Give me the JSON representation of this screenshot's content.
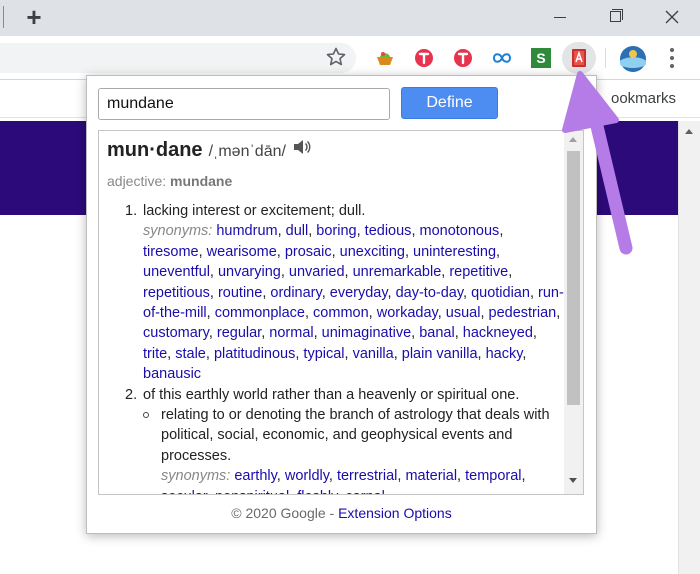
{
  "browser": {
    "new_tab_symbol": "+",
    "bookmarks_label": "ookmarks"
  },
  "popup": {
    "input_value": "mundane",
    "define_label": "Define",
    "headword": "mun·dane",
    "pronunciation": "/ˌmənˈdān/",
    "pos_label": "adjective:",
    "pos_word": "mundane",
    "definitions": [
      {
        "number": "1.",
        "text": "lacking interest or excitement; dull.",
        "synonyms_label": "synonyms:",
        "synonyms": [
          "humdrum",
          "dull",
          "boring",
          "tedious",
          "monotonous",
          "tiresome",
          "wearisome",
          "prosaic",
          "unexciting",
          "uninteresting",
          "uneventful",
          "unvarying",
          "unvaried",
          "unremarkable",
          "repetitive",
          "repetitious",
          "routine",
          "ordinary",
          "everyday",
          "day-to-day",
          "quotidian",
          "run-of-the-mill",
          "commonplace",
          "common",
          "workaday",
          "usual",
          "pedestrian",
          "customary",
          "regular",
          "normal",
          "unimaginative",
          "banal",
          "hackneyed",
          "trite",
          "stale",
          "platitudinous",
          "typical",
          "vanilla",
          "plain vanilla",
          "hacky",
          "banausic"
        ]
      },
      {
        "number": "2.",
        "text": "of this earthly world rather than a heavenly or spiritual one.",
        "sub": {
          "text": "relating to or denoting the branch of astrology that deals with political, social, economic, and geophysical events and processes.",
          "synonyms_label": "synonyms:",
          "synonyms": [
            "earthly",
            "worldly",
            "terrestrial",
            "material",
            "temporal",
            "secular",
            "nonspiritual",
            "fleshly",
            "carnal"
          ]
        }
      }
    ],
    "footer_text": "© 2020 Google - ",
    "footer_link": "Extension Options"
  },
  "colors": {
    "link": "#1a0dab",
    "define_button": "#4d8cf0",
    "page_band": "#2d0a7a",
    "annotation_arrow": "#b57be6"
  }
}
